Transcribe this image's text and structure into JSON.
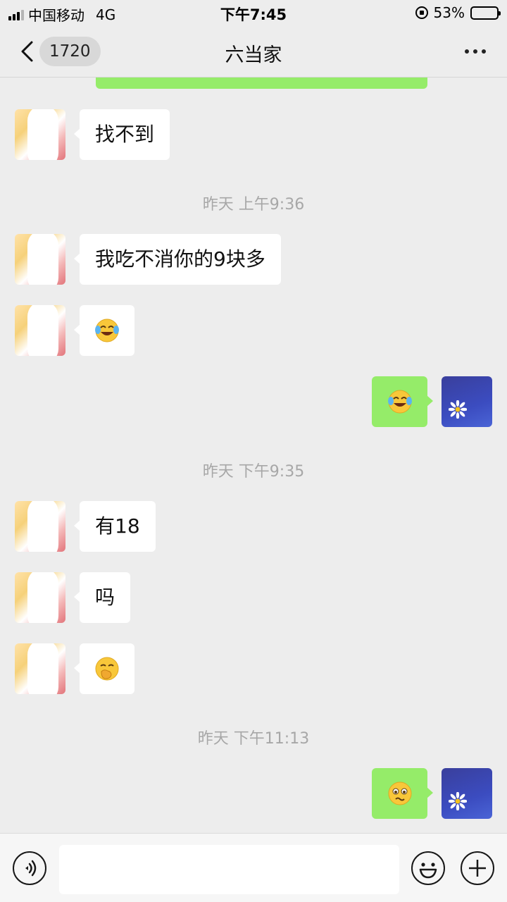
{
  "status_bar": {
    "carrier": "中国移动",
    "network": "4G",
    "time": "下午7:45",
    "battery_text": "53%",
    "battery_level": 0.53
  },
  "header": {
    "back_icon": "chevron-left-icon",
    "unread_badge": "1720",
    "title": "六当家",
    "more_icon": "more-dots-icon"
  },
  "messages": [
    {
      "side": "in",
      "text": "找不到"
    },
    {
      "timestamp": "昨天 上午9:36"
    },
    {
      "side": "in",
      "text": "我吃不消你的9块多"
    },
    {
      "side": "in",
      "emoji": "laughing-crying-emoji"
    },
    {
      "side": "out",
      "emoji": "laughing-crying-emoji"
    },
    {
      "timestamp": "昨天 下午9:35"
    },
    {
      "side": "in",
      "text": "有18"
    },
    {
      "side": "in",
      "text": "吗"
    },
    {
      "side": "in",
      "emoji": "hand-over-mouth-emoji"
    },
    {
      "timestamp": "昨天 下午11:13"
    },
    {
      "side": "out",
      "emoji": "worried-pleading-emoji"
    }
  ],
  "input_bar": {
    "voice_icon": "voice-icon",
    "emoji_icon": "smiley-icon",
    "plus_icon": "plus-icon",
    "input_value": ""
  },
  "colors": {
    "background": "#ededed",
    "outgoing_bubble": "#95ec69",
    "incoming_bubble": "#ffffff",
    "timestamp_text": "#a7a7a7"
  }
}
